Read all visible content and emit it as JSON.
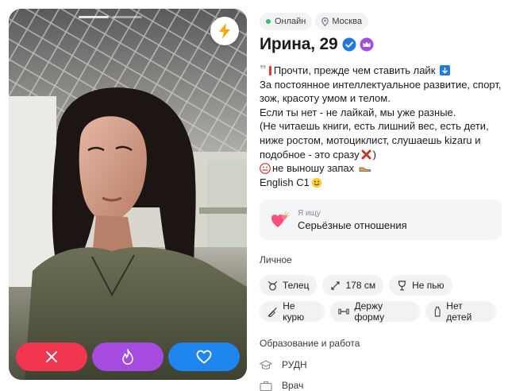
{
  "photo": {
    "buttons": {
      "dislike_icon": "close-icon",
      "super_icon": "flame-icon",
      "like_icon": "heart-icon",
      "boost_icon": "lightning-icon"
    }
  },
  "profile": {
    "status": "Онлайн",
    "city": "Москва",
    "name_age": "Ирина, 29",
    "bio": {
      "line1": "Прочти, прежде чем ставить лайк",
      "line2": "За постоянное интеллектуальное развитие, спорт,",
      "line3": "зож, красоту умом и телом.",
      "line4": "Если ты нет - не лайкай, мы уже разные.",
      "line5": "(Не читаешь книги, есть лишний вес, есть дети,",
      "line6": "ниже ростом, мотоциклист, слушаешь kizaru и",
      "line7a": "подобное - это сразу",
      "line7b": ")",
      "line8": "не выношу запах",
      "line9": "English C1"
    },
    "looking_for": {
      "label": "Я ищу",
      "value": "Серьёзные отношения"
    },
    "personal": {
      "title": "Личное",
      "row1": [
        {
          "icon": "taurus-icon",
          "label": "Телец"
        },
        {
          "icon": "height-icon",
          "label": "178 см"
        },
        {
          "icon": "wine-glass-icon",
          "label": "Не пью"
        }
      ],
      "row2": [
        {
          "icon": "no-smoking-icon",
          "label": "Не курю"
        },
        {
          "icon": "dumbbell-icon",
          "label": "Держу форму"
        },
        {
          "icon": "baby-bottle-icon",
          "label": "Нет детей"
        }
      ]
    },
    "education_work": {
      "title": "Образование и работа",
      "education": "РУДН",
      "job": "Врач"
    }
  },
  "colors": {
    "dislike": "#f2364f",
    "super": "#a64be0",
    "like": "#1f86f0",
    "online": "#33c46b",
    "boost": "#ffa500"
  }
}
